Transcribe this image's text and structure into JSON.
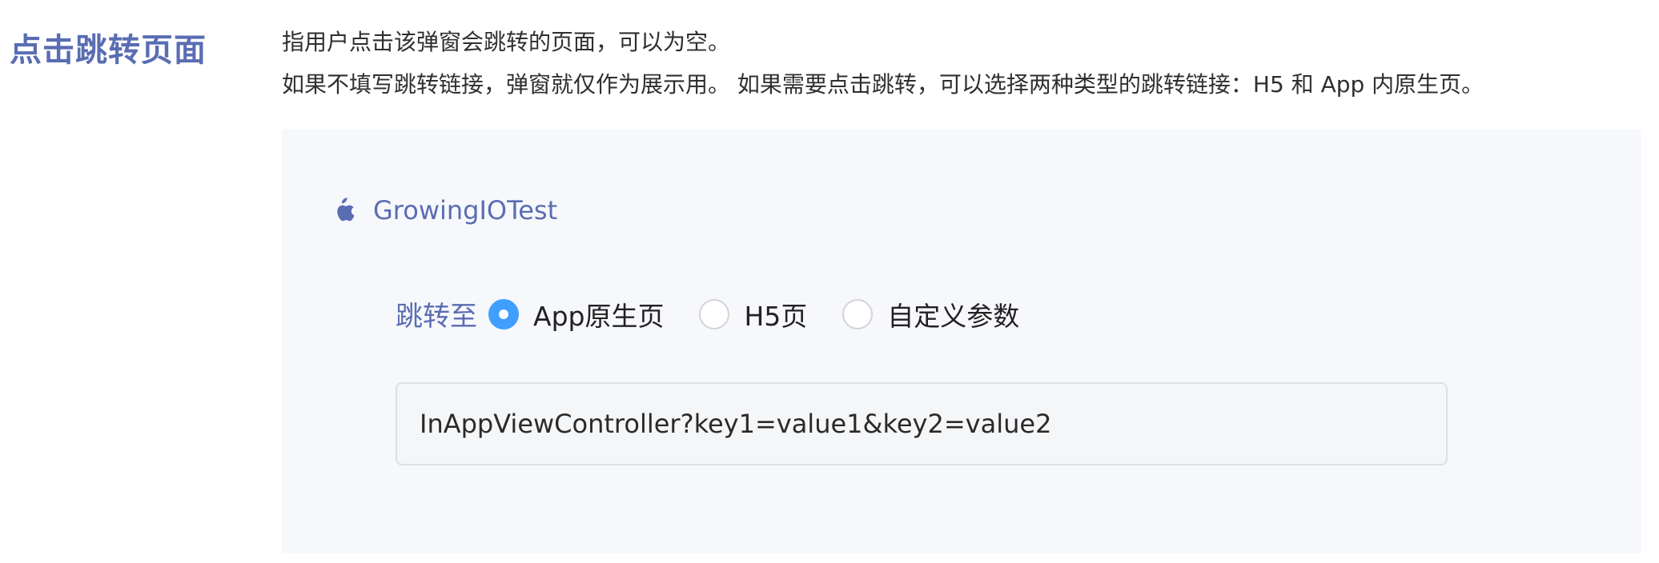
{
  "section": {
    "title": "点击跳转页面"
  },
  "description": {
    "line1": "指用户点击该弹窗会跳转的页面，可以为空。",
    "line2": "如果不填写跳转链接，弹窗就仅作为展示用。 如果需要点击跳转，可以选择两种类型的跳转链接：H5 和 App 内原生页。"
  },
  "app": {
    "icon": "apple-icon",
    "name": "GrowingIOTest"
  },
  "jump": {
    "label": "跳转至",
    "options": [
      {
        "label": "App原生页",
        "checked": true
      },
      {
        "label": "H5页",
        "checked": false
      },
      {
        "label": "自定义参数",
        "checked": false
      }
    ]
  },
  "link_input": {
    "value": "InAppViewController?key1=value1&key2=value2"
  },
  "colors": {
    "accent": "#5a6db3",
    "radio_checked": "#409eff",
    "panel_bg": "#f7f8fc"
  }
}
